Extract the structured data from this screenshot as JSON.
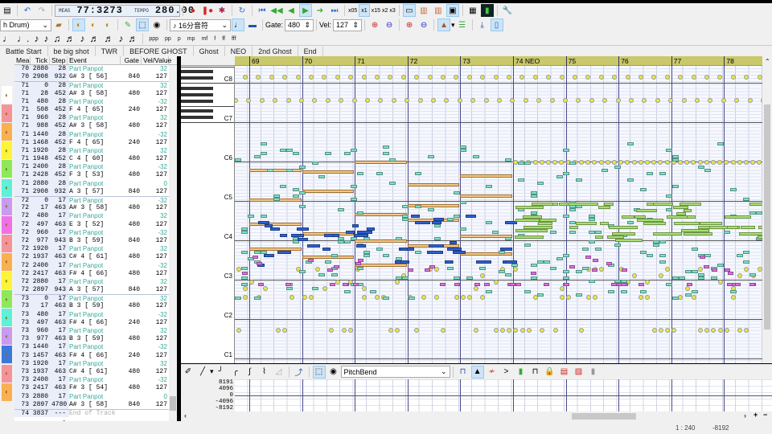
{
  "toolbar": {
    "meas_label": "MEAS",
    "position": "77:3273",
    "tempo_label": "TEMPO",
    "tempo": "280.00",
    "speeds": [
      "x05",
      "x1",
      "x15",
      "x2",
      "x3"
    ],
    "track_select": "h Drum)",
    "note_length": "16分音符",
    "gate_label": "Gate:",
    "gate": "480",
    "vel_label": "Vel:",
    "vel": "127",
    "dynamics": [
      "ppp",
      "pp",
      "p",
      "mp",
      "mf",
      "f",
      "ff",
      "fff"
    ]
  },
  "markers": [
    "Battle Start",
    "be big shot",
    "TWR",
    "BEFORE GHOST",
    "Ghost",
    "NEO",
    "2nd Ghost",
    "End"
  ],
  "event_list": {
    "headers": [
      "Mea",
      "Tick",
      "Step",
      "Event",
      "Gate",
      "Vel/Value"
    ],
    "rows": [
      [
        "70",
        "2880",
        "28",
        "Part Panpot",
        "",
        "32"
      ],
      [
        "70",
        "2908",
        "932",
        "G# 3 [ 56]",
        "840",
        "127"
      ],
      [
        "71",
        "0",
        "28",
        "Part Panpot",
        "",
        "32"
      ],
      [
        "71",
        "28",
        "452",
        "A# 3 [ 58]",
        "480",
        "127"
      ],
      [
        "71",
        "480",
        "28",
        "Part Panpot",
        "",
        "-32"
      ],
      [
        "71",
        "508",
        "452",
        "F  4 [ 65]",
        "240",
        "127"
      ],
      [
        "71",
        "960",
        "28",
        "Part Panpot",
        "",
        "32"
      ],
      [
        "71",
        "988",
        "452",
        "A# 3 [ 58]",
        "480",
        "127"
      ],
      [
        "71",
        "1440",
        "28",
        "Part Panpot",
        "",
        "-32"
      ],
      [
        "71",
        "1468",
        "452",
        "F  4 [ 65]",
        "240",
        "127"
      ],
      [
        "71",
        "1920",
        "28",
        "Part Panpot",
        "",
        "32"
      ],
      [
        "71",
        "1948",
        "452",
        "C  4 [ 60]",
        "480",
        "127"
      ],
      [
        "71",
        "2400",
        "28",
        "Part Panpot",
        "",
        "-32"
      ],
      [
        "71",
        "2428",
        "452",
        "F  3 [ 53]",
        "480",
        "127"
      ],
      [
        "71",
        "2880",
        "28",
        "Part Panpot",
        "",
        "0"
      ],
      [
        "71",
        "2908",
        "932",
        "A  3 [ 57]",
        "840",
        "127"
      ],
      [
        "72",
        "0",
        "17",
        "Part Panpot",
        "",
        "-32"
      ],
      [
        "72",
        "17",
        "463",
        "A# 3 [ 58]",
        "480",
        "127"
      ],
      [
        "72",
        "480",
        "17",
        "Part Panpot",
        "",
        "32"
      ],
      [
        "72",
        "497",
        "463",
        "E  3 [ 52]",
        "480",
        "127"
      ],
      [
        "72",
        "960",
        "17",
        "Part Panpot",
        "",
        "-32"
      ],
      [
        "72",
        "977",
        "943",
        "B  3 [ 59]",
        "840",
        "127"
      ],
      [
        "72",
        "1920",
        "17",
        "Part Panpot",
        "",
        "32"
      ],
      [
        "72",
        "1937",
        "463",
        "C# 4 [ 61]",
        "480",
        "127"
      ],
      [
        "72",
        "2400",
        "17",
        "Part Panpot",
        "",
        "-32"
      ],
      [
        "72",
        "2417",
        "463",
        "F# 4 [ 66]",
        "480",
        "127"
      ],
      [
        "72",
        "2880",
        "17",
        "Part Panpot",
        "",
        "32"
      ],
      [
        "72",
        "2897",
        "943",
        "A  3 [ 57]",
        "840",
        "127"
      ],
      [
        "73",
        "0",
        "17",
        "Part Panpot",
        "",
        "32"
      ],
      [
        "73",
        "17",
        "463",
        "B  3 [ 59]",
        "480",
        "127"
      ],
      [
        "73",
        "480",
        "17",
        "Part Panpot",
        "",
        "-32"
      ],
      [
        "73",
        "497",
        "463",
        "F# 4 [ 66]",
        "240",
        "127"
      ],
      [
        "73",
        "960",
        "17",
        "Part Panpot",
        "",
        "32"
      ],
      [
        "73",
        "977",
        "463",
        "B  3 [ 59]",
        "480",
        "127"
      ],
      [
        "73",
        "1440",
        "17",
        "Part Panpot",
        "",
        "-32"
      ],
      [
        "73",
        "1457",
        "463",
        "F# 4 [ 66]",
        "240",
        "127"
      ],
      [
        "73",
        "1920",
        "17",
        "Part Panpot",
        "",
        "32"
      ],
      [
        "73",
        "1937",
        "463",
        "C# 4 [ 61]",
        "480",
        "127"
      ],
      [
        "73",
        "2400",
        "17",
        "Part Panpot",
        "",
        "-32"
      ],
      [
        "73",
        "2417",
        "463",
        "F# 3 [ 54]",
        "480",
        "127"
      ],
      [
        "73",
        "2880",
        "17",
        "Part Panpot",
        "",
        "0"
      ],
      [
        "73",
        "2897",
        "4780",
        "A# 3 [ 58]",
        "840",
        "127"
      ],
      [
        "74",
        "3837",
        "----",
        "End of Track",
        "",
        ""
      ]
    ]
  },
  "track_colors": [
    "#ffffff",
    "#f6939a",
    "#f9b053",
    "#fbf43a",
    "#8de85a",
    "#5ef0d8",
    "#c89af0",
    "#f070e8",
    "#f6939a",
    "#f9b053",
    "#fbf43a",
    "#8de85a",
    "#5ef0d8",
    "#c89af0",
    "#3c78d8",
    "#f6939a",
    "#f9b053"
  ],
  "ruler": [
    "69",
    "70",
    "71",
    "72",
    "73",
    "74 NEO",
    "75",
    "76",
    "77",
    "78"
  ],
  "octaves": [
    "C8",
    "C7",
    "C6",
    "C5",
    "C4",
    "C3",
    "C2",
    "C1"
  ],
  "controller": {
    "type": "PitchBend",
    "labels": [
      "8191",
      "4096",
      "0",
      "-4096",
      "-8192"
    ]
  },
  "status": {
    "ratio": "1 : 240",
    "value": "-8192"
  }
}
